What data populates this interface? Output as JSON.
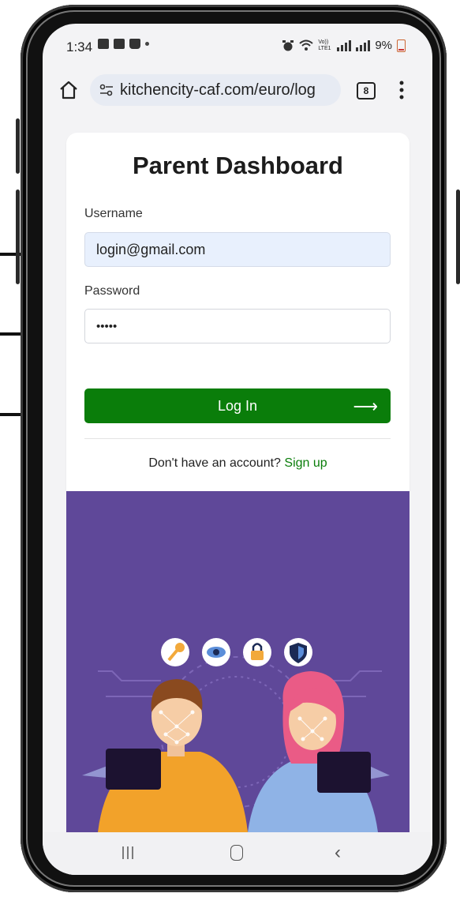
{
  "status": {
    "time": "1:34",
    "battery": "9%",
    "volte": "Vo)) LTE1"
  },
  "browser": {
    "url": "kitchencity-caf.com/euro/log",
    "tab_count": "8"
  },
  "page": {
    "title": "Parent Dashboard",
    "username_label": "Username",
    "username_value": "login@gmail.com",
    "password_label": "Password",
    "password_value": "•••••",
    "login_label": "Log In",
    "login_arrow": "⟶",
    "signup_prompt": "Don't have an account?",
    "signup_link": "Sign up"
  },
  "colors": {
    "accent_green": "#0a7d0a",
    "illustration_bg": "#5f4899",
    "input_fill": "#e8f0fd"
  },
  "icons": [
    "home-icon",
    "site-settings-icon",
    "tab-switcher-icon",
    "menu-dots-icon",
    "key-icon",
    "eye-icon",
    "lock-icon",
    "shield-icon",
    "recents-icon",
    "home-nav-icon",
    "back-icon"
  ]
}
